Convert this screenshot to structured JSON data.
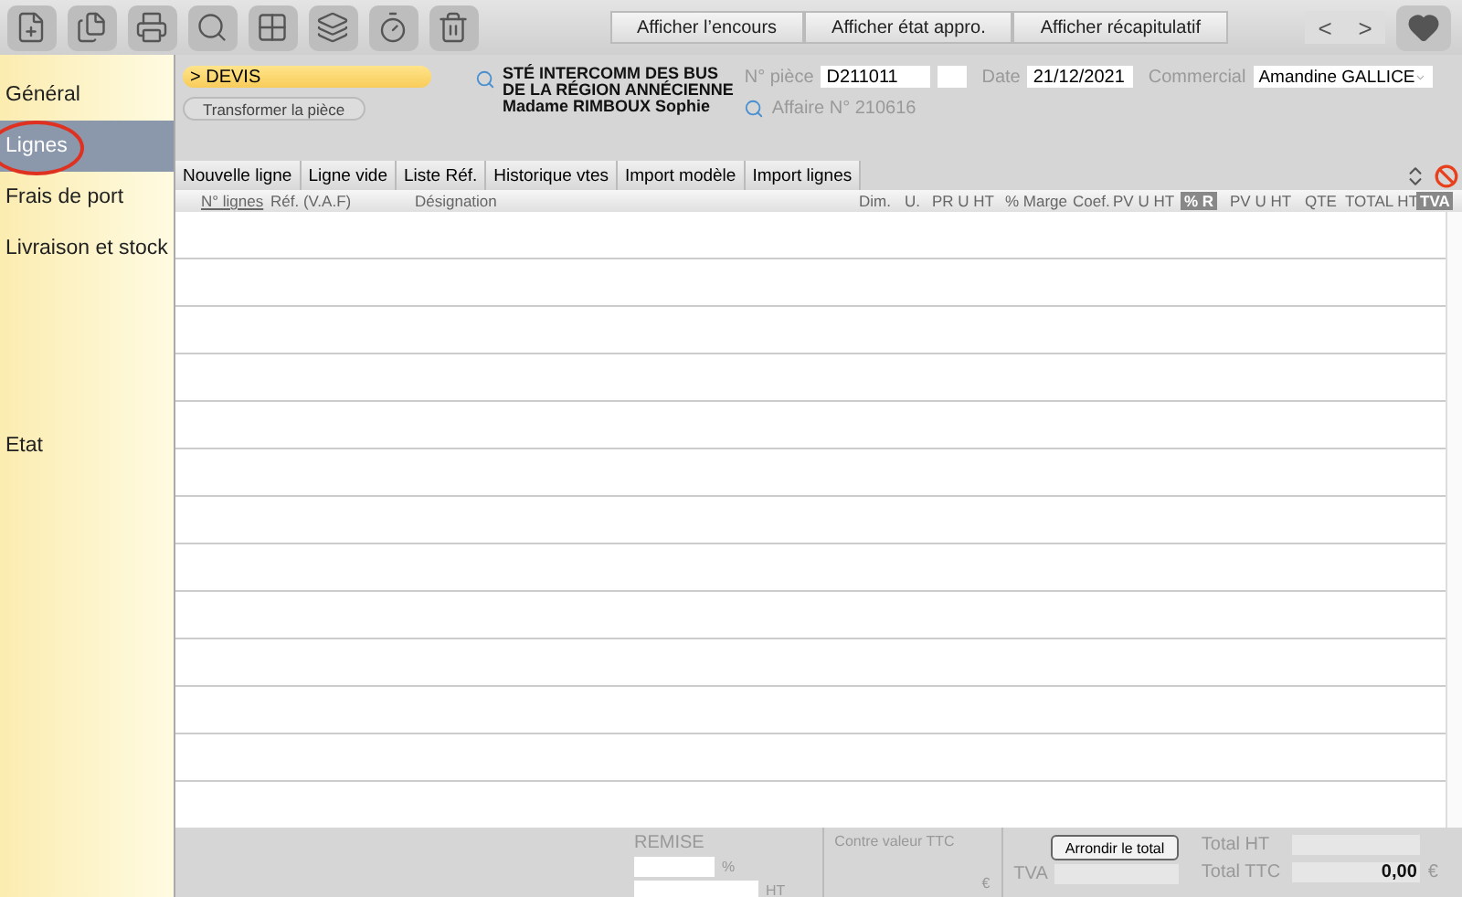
{
  "toolbar": {
    "tools": [
      {
        "kind": "new-doc"
      },
      {
        "kind": "copy-doc"
      },
      {
        "kind": "print"
      },
      {
        "kind": "search"
      },
      {
        "kind": "grid"
      },
      {
        "kind": "stack"
      },
      {
        "kind": "timer"
      },
      {
        "kind": "trash"
      }
    ],
    "buttons": [
      "Afficher l’encours",
      "Afficher état appro.",
      "Afficher récapitulatif"
    ],
    "nav": [
      "<",
      ">"
    ]
  },
  "sidebar": {
    "items": [
      {
        "label": "Général",
        "selected": false
      },
      {
        "label": "Lignes",
        "selected": true,
        "circled": true
      },
      {
        "label": "Frais de port",
        "selected": false
      },
      {
        "label": "Livraison et stock",
        "selected": false
      },
      {
        "label": "Etat",
        "selected": false
      }
    ]
  },
  "document": {
    "type": "> DEVIS",
    "transform_button": "Transformer la pièce",
    "client": [
      "STÉ INTERCOMM DES BUS",
      "DE LA RÉGION ANNÉCIENNE",
      "Madame RIMBOUX Sophie"
    ],
    "piece_label": "N° pièce",
    "piece": "D211011",
    "date_label": "Date",
    "date": "21/12/2021",
    "commercial_label": "Commercial",
    "commercial": "Amandine GALLICE",
    "affaire": "Affaire N° 210616"
  },
  "actions": [
    "Nouvelle ligne",
    "Ligne vide",
    "Liste Réf.",
    "Historique vtes",
    "Import modèle",
    "Import lignes"
  ],
  "table": {
    "columns": [
      {
        "label": "N° lignes",
        "kind": "link"
      },
      {
        "label": "Réf. (V.A.F)",
        "kind": "plain"
      },
      {
        "label": "Désignation",
        "kind": "plain"
      },
      {
        "label": "Dim.",
        "kind": "plain"
      },
      {
        "label": "U.",
        "kind": "plain"
      },
      {
        "label": "PR U HT",
        "kind": "plain"
      },
      {
        "label": "% Marge",
        "kind": "plain"
      },
      {
        "label": "Coef.",
        "kind": "plain"
      },
      {
        "label": "PV U HT",
        "kind": "plain"
      },
      {
        "label": "% R",
        "kind": "badge"
      },
      {
        "label": "PV U HT",
        "kind": "plain"
      },
      {
        "label": "QTE",
        "kind": "plain"
      },
      {
        "label": "TOTAL HT",
        "kind": "plain"
      },
      {
        "label": "TVA",
        "kind": "badge"
      }
    ]
  },
  "footer": {
    "remise_label": "REMISE",
    "percent": "%",
    "ht": "HT",
    "contre_valeur": "Contre valeur TTC",
    "euro": "€",
    "round_button": "Arrondir le total",
    "tva_label": "TVA",
    "total_ht_label": "Total HT",
    "total_ttc_label": "Total TTC",
    "total_ttc": "0,00",
    "total_currency": "€"
  }
}
